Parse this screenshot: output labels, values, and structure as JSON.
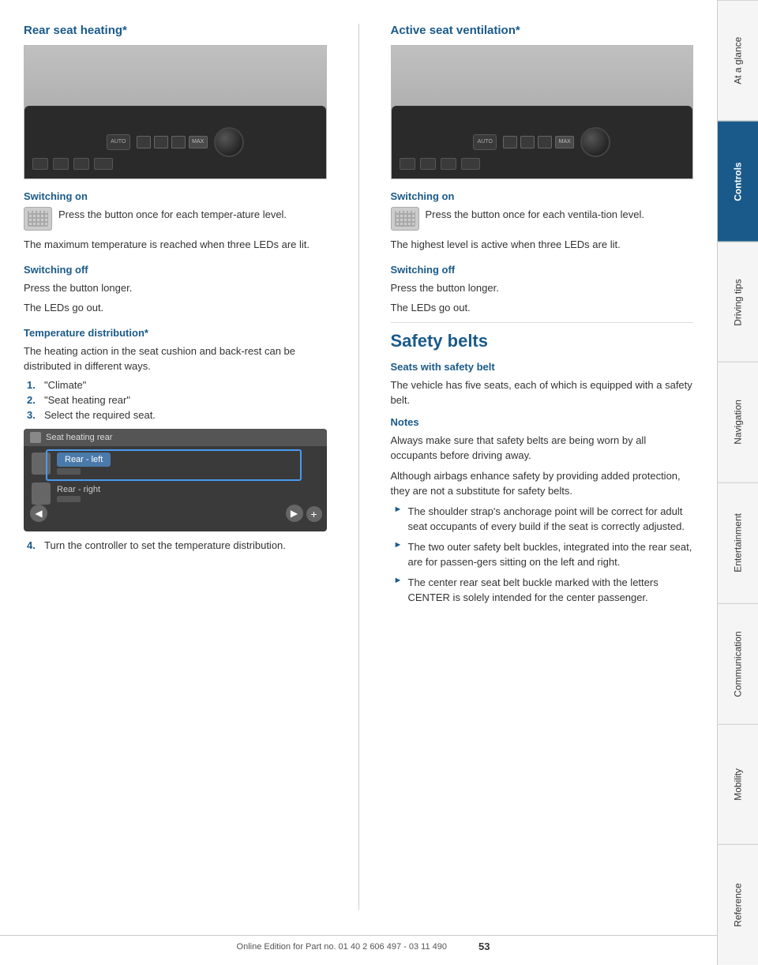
{
  "page": {
    "number": "53",
    "footer": "Online Edition for Part no. 01 40 2 606 497 - 03 11 490"
  },
  "sidebar": {
    "items": [
      {
        "label": "At a glance",
        "active": false
      },
      {
        "label": "Controls",
        "active": true
      },
      {
        "label": "Driving tips",
        "active": false
      },
      {
        "label": "Navigation",
        "active": false
      },
      {
        "label": "Entertainment",
        "active": false
      },
      {
        "label": "Communication",
        "active": false
      },
      {
        "label": "Mobility",
        "active": false
      },
      {
        "label": "Reference",
        "active": false
      }
    ]
  },
  "left_column": {
    "section_title": "Rear seat heating*",
    "switching_on": {
      "title": "Switching on",
      "icon_label": "seat-heat-icon",
      "description": "Press the button once for each temper-ature level.",
      "note": "The maximum temperature is reached when three LEDs are lit."
    },
    "switching_off": {
      "title": "Switching off",
      "line1": "Press the button longer.",
      "line2": "The LEDs go out."
    },
    "temperature_distribution": {
      "title": "Temperature distribution*",
      "description": "The heating action in the seat cushion and back-rest can be distributed in different ways.",
      "steps": [
        {
          "num": "1.",
          "text": "\"Climate\""
        },
        {
          "num": "2.",
          "text": "\"Seat heating rear\""
        },
        {
          "num": "3.",
          "text": "Select the required seat."
        }
      ],
      "screen_header": "Seat heating rear",
      "screen_row1": "Rear - left",
      "screen_row2": "Rear - right",
      "step4": {
        "num": "4.",
        "text": "Turn the controller to set the temperature distribution."
      }
    }
  },
  "right_column": {
    "section_title": "Active seat ventilation*",
    "switching_on": {
      "title": "Switching on",
      "icon_label": "seat-vent-icon",
      "description": "Press the button once for each ventila-tion level.",
      "note": "The highest level is active when three LEDs are lit."
    },
    "switching_off": {
      "title": "Switching off",
      "line1": "Press the button longer.",
      "line2": "The LEDs go out."
    },
    "safety_belts": {
      "big_title": "Safety belts",
      "seats_title": "Seats with safety belt",
      "seats_text": "The vehicle has five seats, each of which is equipped with a safety belt.",
      "notes_title": "Notes",
      "note1": "Always make sure that safety belts are being worn by all occupants before driving away.",
      "note2": "Although airbags enhance safety by providing added protection, they are not a substitute for safety belts.",
      "bullets": [
        "The shoulder strap's anchorage point will be correct for adult seat occupants of every build if the seat is correctly adjusted.",
        "The two outer safety belt buckles, integrated into the rear seat, are for passen-gers sitting on the left and right.",
        "The center rear seat belt buckle marked with the letters CENTER is solely intended for the center passenger."
      ]
    }
  }
}
